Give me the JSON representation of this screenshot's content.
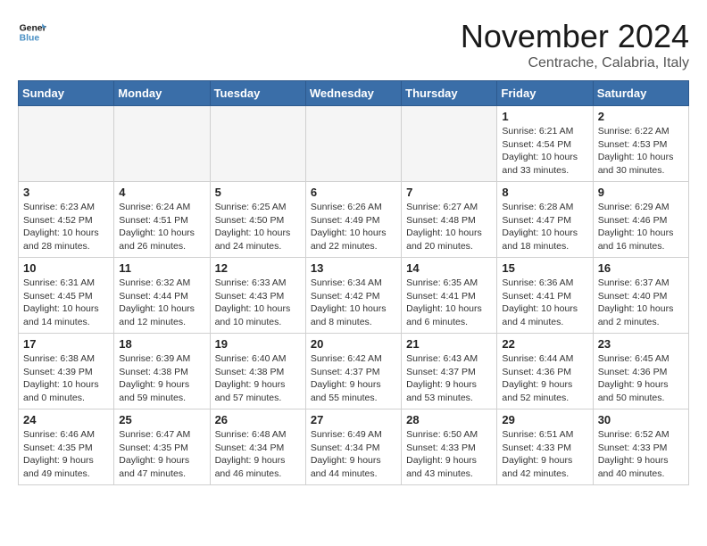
{
  "header": {
    "logo_line1": "General",
    "logo_line2": "Blue",
    "title": "November 2024",
    "location": "Centrache, Calabria, Italy"
  },
  "weekdays": [
    "Sunday",
    "Monday",
    "Tuesday",
    "Wednesday",
    "Thursday",
    "Friday",
    "Saturday"
  ],
  "weeks": [
    [
      {
        "day": "",
        "info": ""
      },
      {
        "day": "",
        "info": ""
      },
      {
        "day": "",
        "info": ""
      },
      {
        "day": "",
        "info": ""
      },
      {
        "day": "",
        "info": ""
      },
      {
        "day": "1",
        "info": "Sunrise: 6:21 AM\nSunset: 4:54 PM\nDaylight: 10 hours\nand 33 minutes."
      },
      {
        "day": "2",
        "info": "Sunrise: 6:22 AM\nSunset: 4:53 PM\nDaylight: 10 hours\nand 30 minutes."
      }
    ],
    [
      {
        "day": "3",
        "info": "Sunrise: 6:23 AM\nSunset: 4:52 PM\nDaylight: 10 hours\nand 28 minutes."
      },
      {
        "day": "4",
        "info": "Sunrise: 6:24 AM\nSunset: 4:51 PM\nDaylight: 10 hours\nand 26 minutes."
      },
      {
        "day": "5",
        "info": "Sunrise: 6:25 AM\nSunset: 4:50 PM\nDaylight: 10 hours\nand 24 minutes."
      },
      {
        "day": "6",
        "info": "Sunrise: 6:26 AM\nSunset: 4:49 PM\nDaylight: 10 hours\nand 22 minutes."
      },
      {
        "day": "7",
        "info": "Sunrise: 6:27 AM\nSunset: 4:48 PM\nDaylight: 10 hours\nand 20 minutes."
      },
      {
        "day": "8",
        "info": "Sunrise: 6:28 AM\nSunset: 4:47 PM\nDaylight: 10 hours\nand 18 minutes."
      },
      {
        "day": "9",
        "info": "Sunrise: 6:29 AM\nSunset: 4:46 PM\nDaylight: 10 hours\nand 16 minutes."
      }
    ],
    [
      {
        "day": "10",
        "info": "Sunrise: 6:31 AM\nSunset: 4:45 PM\nDaylight: 10 hours\nand 14 minutes."
      },
      {
        "day": "11",
        "info": "Sunrise: 6:32 AM\nSunset: 4:44 PM\nDaylight: 10 hours\nand 12 minutes."
      },
      {
        "day": "12",
        "info": "Sunrise: 6:33 AM\nSunset: 4:43 PM\nDaylight: 10 hours\nand 10 minutes."
      },
      {
        "day": "13",
        "info": "Sunrise: 6:34 AM\nSunset: 4:42 PM\nDaylight: 10 hours\nand 8 minutes."
      },
      {
        "day": "14",
        "info": "Sunrise: 6:35 AM\nSunset: 4:41 PM\nDaylight: 10 hours\nand 6 minutes."
      },
      {
        "day": "15",
        "info": "Sunrise: 6:36 AM\nSunset: 4:41 PM\nDaylight: 10 hours\nand 4 minutes."
      },
      {
        "day": "16",
        "info": "Sunrise: 6:37 AM\nSunset: 4:40 PM\nDaylight: 10 hours\nand 2 minutes."
      }
    ],
    [
      {
        "day": "17",
        "info": "Sunrise: 6:38 AM\nSunset: 4:39 PM\nDaylight: 10 hours\nand 0 minutes."
      },
      {
        "day": "18",
        "info": "Sunrise: 6:39 AM\nSunset: 4:38 PM\nDaylight: 9 hours\nand 59 minutes."
      },
      {
        "day": "19",
        "info": "Sunrise: 6:40 AM\nSunset: 4:38 PM\nDaylight: 9 hours\nand 57 minutes."
      },
      {
        "day": "20",
        "info": "Sunrise: 6:42 AM\nSunset: 4:37 PM\nDaylight: 9 hours\nand 55 minutes."
      },
      {
        "day": "21",
        "info": "Sunrise: 6:43 AM\nSunset: 4:37 PM\nDaylight: 9 hours\nand 53 minutes."
      },
      {
        "day": "22",
        "info": "Sunrise: 6:44 AM\nSunset: 4:36 PM\nDaylight: 9 hours\nand 52 minutes."
      },
      {
        "day": "23",
        "info": "Sunrise: 6:45 AM\nSunset: 4:36 PM\nDaylight: 9 hours\nand 50 minutes."
      }
    ],
    [
      {
        "day": "24",
        "info": "Sunrise: 6:46 AM\nSunset: 4:35 PM\nDaylight: 9 hours\nand 49 minutes."
      },
      {
        "day": "25",
        "info": "Sunrise: 6:47 AM\nSunset: 4:35 PM\nDaylight: 9 hours\nand 47 minutes."
      },
      {
        "day": "26",
        "info": "Sunrise: 6:48 AM\nSunset: 4:34 PM\nDaylight: 9 hours\nand 46 minutes."
      },
      {
        "day": "27",
        "info": "Sunrise: 6:49 AM\nSunset: 4:34 PM\nDaylight: 9 hours\nand 44 minutes."
      },
      {
        "day": "28",
        "info": "Sunrise: 6:50 AM\nSunset: 4:33 PM\nDaylight: 9 hours\nand 43 minutes."
      },
      {
        "day": "29",
        "info": "Sunrise: 6:51 AM\nSunset: 4:33 PM\nDaylight: 9 hours\nand 42 minutes."
      },
      {
        "day": "30",
        "info": "Sunrise: 6:52 AM\nSunset: 4:33 PM\nDaylight: 9 hours\nand 40 minutes."
      }
    ]
  ]
}
